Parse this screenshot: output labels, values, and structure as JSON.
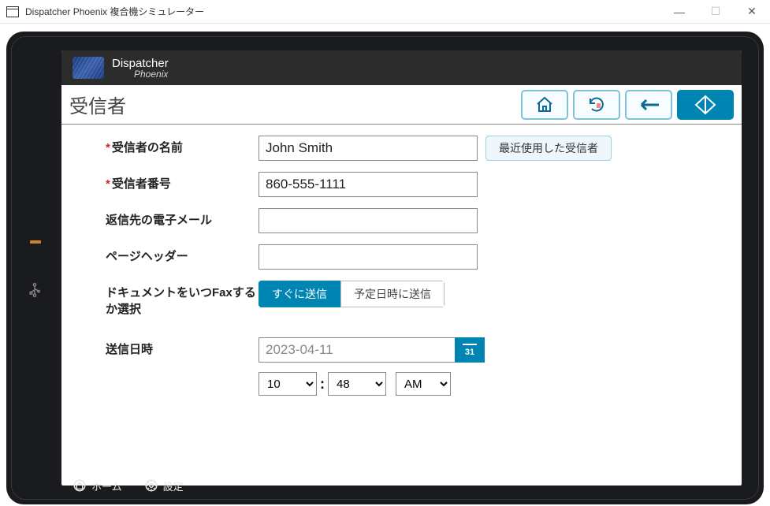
{
  "window": {
    "title": "Dispatcher Phoenix 複合機シミュレーター"
  },
  "banner": {
    "line1": "Dispatcher",
    "line2": "Phoenix"
  },
  "page_title": "受信者",
  "labels": {
    "recipient_name": "受信者の名前",
    "recipient_number": "受信者番号",
    "reply_email": "返信先の電子メール",
    "page_header": "ページヘッダー",
    "when_to_fax": "ドキュメントをいつFaxするか選択",
    "send_datetime": "送信日時"
  },
  "values": {
    "recipient_name": "John Smith",
    "recipient_number": "860-555-1111",
    "reply_email": "",
    "page_header": "",
    "send_date": "2023-04-11",
    "hour": "10",
    "minute": "48",
    "ampm": "AM"
  },
  "buttons": {
    "recent_recipients": "最近使用した受信者",
    "send_now": "すぐに送信",
    "send_scheduled": "予定日時に送信",
    "calendar_day": "31"
  },
  "time_separator": ":",
  "dock": {
    "home": "ホーム",
    "settings": "設定"
  }
}
